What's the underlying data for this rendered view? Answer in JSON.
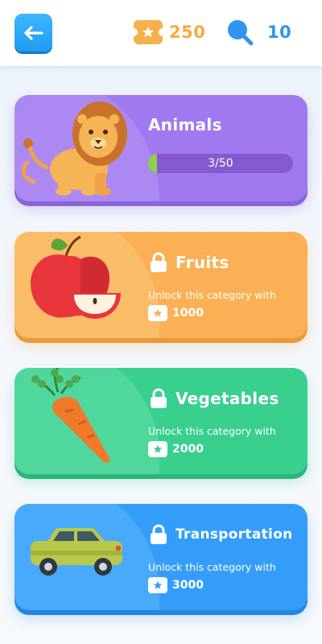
{
  "header": {
    "tickets": "250",
    "hints": "10",
    "colors": {
      "ticket": "#f6ab3f",
      "hint": "#2f95ee",
      "back": "#2aa7f7"
    }
  },
  "categories": [
    {
      "name": "Animals",
      "locked": false,
      "progress_text": "3/50",
      "progress_fraction": 0.06,
      "color": "#a078ef",
      "icon": "lion-illustration"
    },
    {
      "name": "Fruits",
      "locked": true,
      "unlock_text": "Unlock this category with",
      "cost": "1000",
      "color": "#fbb055",
      "icon": "apple-illustration"
    },
    {
      "name": "Vegetables",
      "locked": true,
      "unlock_text": "Unlock this category with",
      "cost": "2000",
      "color": "#38cf8f",
      "icon": "carrot-illustration"
    },
    {
      "name": "Transportation",
      "locked": true,
      "unlock_text": "Unlock this category with",
      "cost": "3000",
      "color": "#349df9",
      "icon": "car-illustration"
    }
  ]
}
